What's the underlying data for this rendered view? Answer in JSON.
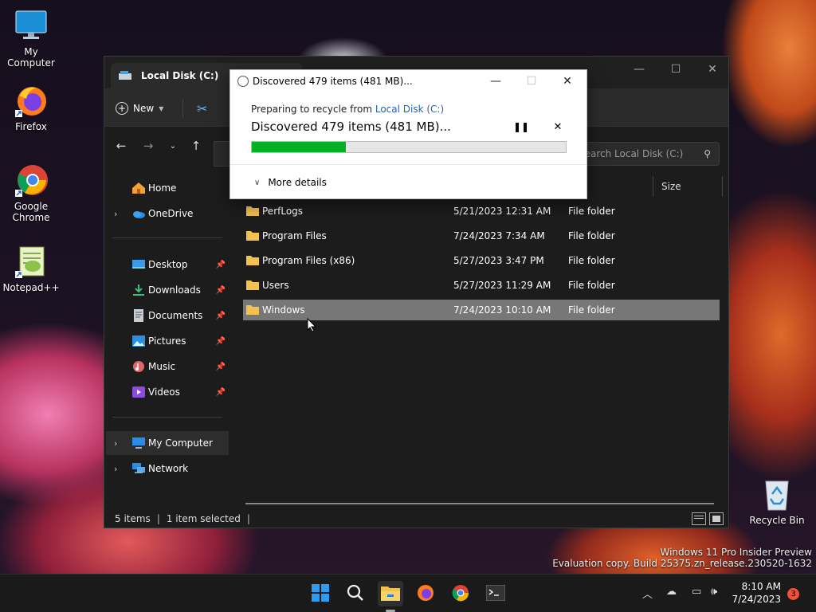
{
  "desktop": {
    "icons": [
      {
        "label": "My Computer"
      },
      {
        "label": "Firefox"
      },
      {
        "label": "Google Chrome"
      },
      {
        "label": "Notepad++"
      },
      {
        "label": "Recycle Bin"
      }
    ],
    "watermark": {
      "line1": "Windows 11 Pro Insider Preview",
      "line2": "Evaluation copy. Build 25375.zn_release.230520-1632"
    }
  },
  "explorer": {
    "tab_title": "Local Disk (C:)",
    "new_label": "New",
    "search_placeholder": "Search Local Disk (C:)",
    "column_size": "Size",
    "sidebar": [
      {
        "label": "Home"
      },
      {
        "label": "OneDrive"
      },
      {
        "label": "Desktop"
      },
      {
        "label": "Downloads"
      },
      {
        "label": "Documents"
      },
      {
        "label": "Pictures"
      },
      {
        "label": "Music"
      },
      {
        "label": "Videos"
      },
      {
        "label": "My Computer"
      },
      {
        "label": "Network"
      }
    ],
    "rows": [
      {
        "name": "PerfLogs",
        "date": "5/21/2023 12:31 AM",
        "type": "File folder"
      },
      {
        "name": "Program Files",
        "date": "7/24/2023 7:34 AM",
        "type": "File folder"
      },
      {
        "name": "Program Files (x86)",
        "date": "5/27/2023 3:47 PM",
        "type": "File folder"
      },
      {
        "name": "Users",
        "date": "5/27/2023 11:29 AM",
        "type": "File folder"
      },
      {
        "name": "Windows",
        "date": "7/24/2023 10:10 AM",
        "type": "File folder"
      }
    ],
    "status": {
      "items": "5 items",
      "selected": "1 item selected"
    }
  },
  "dialog": {
    "title": "Discovered 479 items (481 MB)...",
    "sub_prefix": "Preparing to recycle from",
    "sub_link": "Local Disk (C:)",
    "main": "Discovered 479 items (481 MB)...",
    "progress_percent": 30,
    "more_details": "More details"
  },
  "taskbar": {
    "time": "8:10 AM",
    "date": "7/24/2023",
    "badge": "3"
  },
  "colors": {
    "accent_progress": "#06b025",
    "link": "#2a62a8",
    "selected_row": "#777777"
  }
}
